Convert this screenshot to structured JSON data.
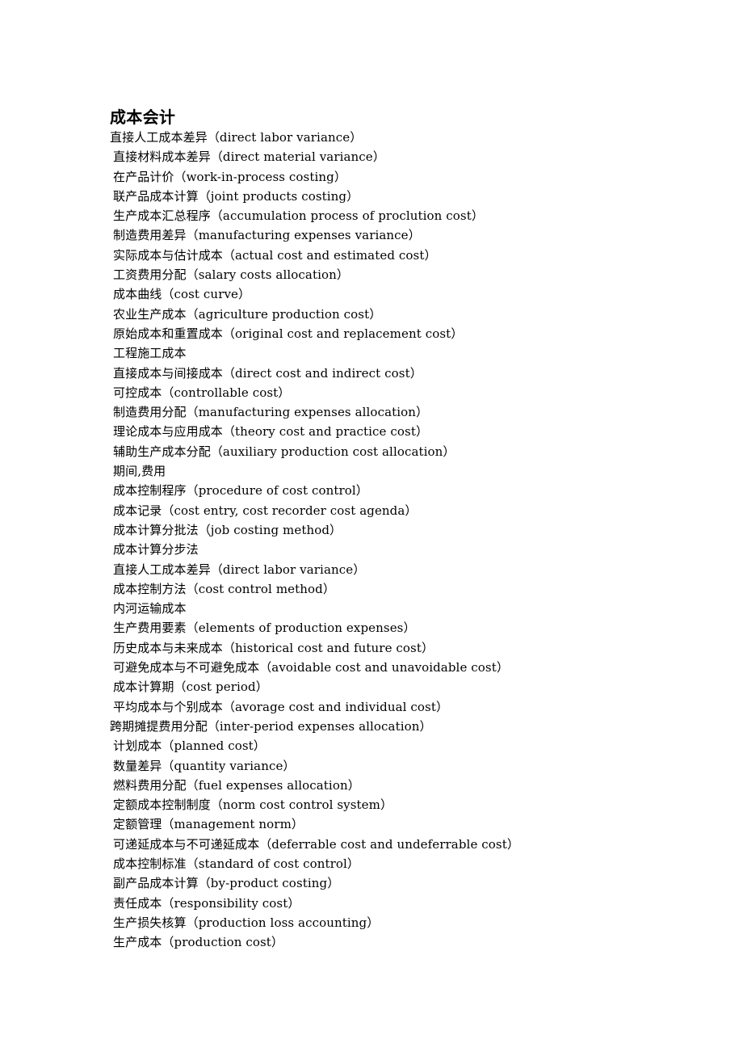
{
  "document": {
    "title": "成本会计",
    "terms": [
      {
        "zh": "直接人工成本差异",
        "en": "（direct labor variance）",
        "outdent": true
      },
      {
        "zh": "直接材料成本差异",
        "en": "（direct material variance）",
        "outdent": false
      },
      {
        "zh": "在产品计价",
        "en": "（work-in-process costing）",
        "outdent": false
      },
      {
        "zh": "联产品成本计算",
        "en": "（joint products costing）",
        "outdent": false
      },
      {
        "zh": "生产成本汇总程序",
        "en": "（accumulation process of proclution cost）",
        "outdent": false
      },
      {
        "zh": "制造费用差异",
        "en": "（manufacturing expenses variance）",
        "outdent": false
      },
      {
        "zh": "实际成本与估计成本",
        "en": "（actual cost and estimated cost）",
        "outdent": false
      },
      {
        "zh": "工资费用分配",
        "en": "（salary costs allocation）",
        "outdent": false
      },
      {
        "zh": "成本曲线",
        "en": "（cost curve）",
        "outdent": false
      },
      {
        "zh": "农业生产成本",
        "en": "（agriculture production cost）",
        "outdent": false
      },
      {
        "zh": "原始成本和重置成本",
        "en": "（original cost and replacement cost）",
        "outdent": false
      },
      {
        "zh": "工程施工成本",
        "en": "",
        "outdent": false
      },
      {
        "zh": "直接成本与间接成本",
        "en": "（direct cost and indirect cost）",
        "outdent": false
      },
      {
        "zh": "可控成本",
        "en": "（controllable cost）",
        "outdent": false
      },
      {
        "zh": "制造费用分配",
        "en": "（manufacturing expenses allocation）",
        "outdent": false
      },
      {
        "zh": "理论成本与应用成本",
        "en": "（theory cost and practice cost）",
        "outdent": false
      },
      {
        "zh": "辅助生产成本分配",
        "en": "（auxiliary production cost allocation）",
        "outdent": false
      },
      {
        "zh": "期间,费用",
        "en": "",
        "outdent": false
      },
      {
        "zh": "成本控制程序",
        "en": "（procedure of cost control）",
        "outdent": false
      },
      {
        "zh": "成本记录",
        "en": "（cost entry, cost recorder cost agenda）",
        "outdent": false
      },
      {
        "zh": "成本计算分批法",
        "en": "（job costing method）",
        "outdent": false
      },
      {
        "zh": "成本计算分步法",
        "en": "",
        "outdent": false
      },
      {
        "zh": "直接人工成本差异",
        "en": "（direct labor variance）",
        "outdent": false
      },
      {
        "zh": "成本控制方法",
        "en": "（cost control method）",
        "outdent": false
      },
      {
        "zh": "内河运输成本",
        "en": "",
        "outdent": false
      },
      {
        "zh": "生产费用要素",
        "en": "（elements of production expenses）",
        "outdent": false
      },
      {
        "zh": "历史成本与未来成本",
        "en": "（historical cost and future cost）",
        "outdent": false
      },
      {
        "zh": "可避免成本与不可避免成本",
        "en": "（avoidable cost and unavoidable cost）",
        "outdent": false
      },
      {
        "zh": "成本计算期",
        "en": "（cost period）",
        "outdent": false
      },
      {
        "zh": "平均成本与个别成本",
        "en": "（avorage cost and individual cost）",
        "outdent": false
      },
      {
        "zh": "跨期摊提费用分配",
        "en": "（inter-period expenses allocation）",
        "outdent": true
      },
      {
        "zh": "计划成本",
        "en": "（planned cost）",
        "outdent": false
      },
      {
        "zh": "数量差异",
        "en": "（quantity variance）",
        "outdent": false
      },
      {
        "zh": "燃料费用分配",
        "en": "（fuel expenses allocation）",
        "outdent": false
      },
      {
        "zh": "定额成本控制制度",
        "en": "（norm cost control system）",
        "outdent": false
      },
      {
        "zh": "定额管理",
        "en": "（management norm）",
        "outdent": false
      },
      {
        "zh": "可递延成本与不可递延成本",
        "en": "（deferrable cost and undeferrable cost）",
        "outdent": false
      },
      {
        "zh": "成本控制标准",
        "en": "（standard of cost control）",
        "outdent": false
      },
      {
        "zh": "副产品成本计算",
        "en": "（by-product costing）",
        "outdent": false
      },
      {
        "zh": "责任成本",
        "en": "（responsibility cost）",
        "outdent": false
      },
      {
        "zh": "生产损失核算",
        "en": "（production loss accounting）",
        "outdent": false
      },
      {
        "zh": "生产成本",
        "en": "（production cost）",
        "outdent": false
      }
    ]
  }
}
